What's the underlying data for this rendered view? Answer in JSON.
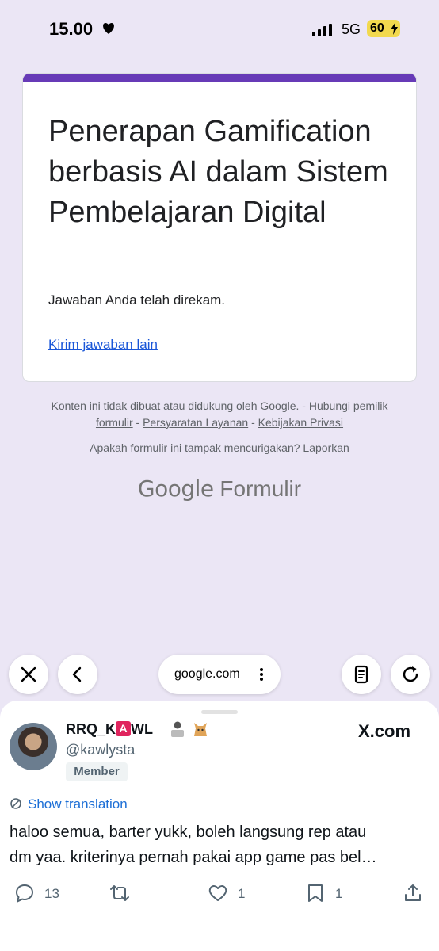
{
  "status_bar": {
    "time": "15.00",
    "network": "5G",
    "battery": "60"
  },
  "form": {
    "title": "Penerapan Gamification berbasis AI dalam Sistem Pembelajaran Digital",
    "confirmation": "Jawaban Anda telah direkam.",
    "submit_another": "Kirim jawaban lain"
  },
  "footer": {
    "disclaimer": "Konten ini tidak dibuat atau didukung oleh Google. - ",
    "contact_owner": "Hubungi pemilik formulir",
    "sep1": " - ",
    "terms": "Persyaratan Layanan",
    "sep2": " - ",
    "privacy": "Kebijakan Privasi",
    "report_question": "Apakah formulir ini tampak mencurigakan? ",
    "report_link": "Laporkan",
    "logo_google": "Google",
    "logo_product": "Formulir"
  },
  "browser": {
    "url": "google.com"
  },
  "tweet": {
    "name_part1": "RRQ_K",
    "name_badge": "A",
    "name_part2": "WL",
    "handle": "@kawlysta",
    "member_label": "Member",
    "site": "X.com",
    "show_translation": "Show translation",
    "text_line1": "haloo semua, barter yukk, boleh langsung rep atau",
    "text_line2": "dm yaa. kriterinya pernah pakai app game pas bel…",
    "replies": "13",
    "likes": "1",
    "bookmarks": "1"
  },
  "colors": {
    "form_accent": "#673ab7",
    "link": "#1a56d8",
    "page_bg": "#ebe6f5"
  }
}
